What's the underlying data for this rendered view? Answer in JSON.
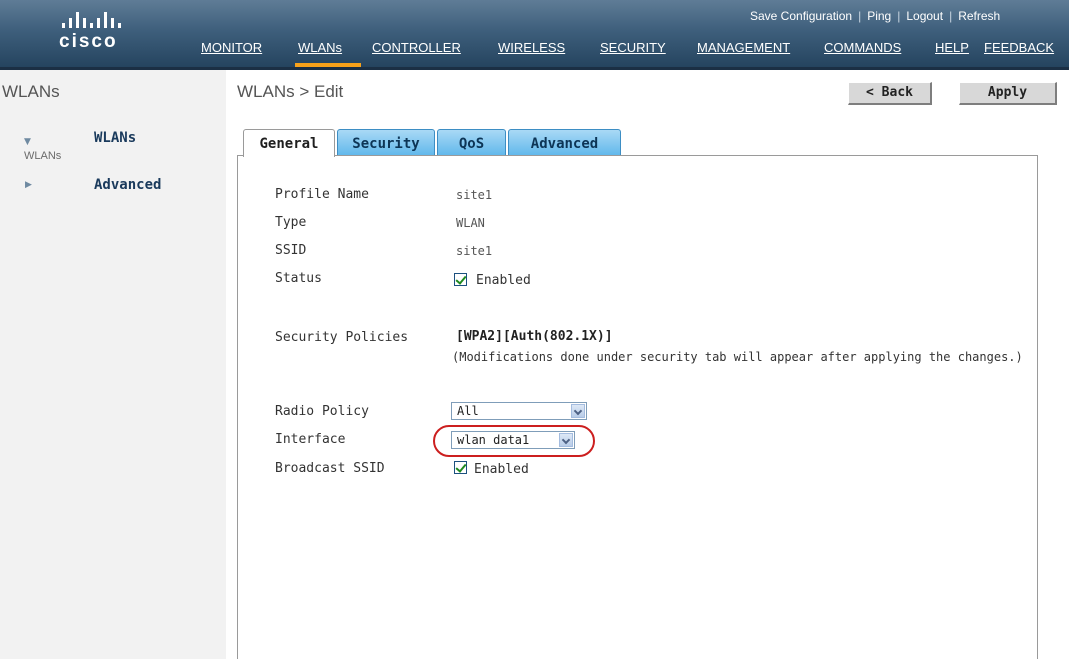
{
  "header": {
    "brand": "cisco",
    "utility": [
      {
        "label": "Save Configuration"
      },
      {
        "label": "Ping"
      },
      {
        "label": "Logout"
      },
      {
        "label": "Refresh"
      }
    ],
    "menu": [
      {
        "label": "MONITOR"
      },
      {
        "label": "WLANs"
      },
      {
        "label": "CONTROLLER"
      },
      {
        "label": "WIRELESS"
      },
      {
        "label": "SECURITY"
      },
      {
        "label": "MANAGEMENT"
      },
      {
        "label": "COMMANDS"
      },
      {
        "label": "HELP"
      },
      {
        "label": "FEEDBACK"
      }
    ],
    "active_menu": "WLANs",
    "accent_color": "#f8a21a"
  },
  "sidebar": {
    "title": "WLANs",
    "items": [
      {
        "label": "WLANs",
        "sub": "WLANs",
        "expanded": true
      },
      {
        "label": "Advanced",
        "expanded": false
      }
    ]
  },
  "main": {
    "breadcrumb": "WLANs > Edit",
    "back_button": "< Back",
    "apply_button": "Apply",
    "tabs": [
      {
        "label": "General",
        "active": true
      },
      {
        "label": "Security",
        "active": false
      },
      {
        "label": "QoS",
        "active": false
      },
      {
        "label": "Advanced",
        "active": false
      }
    ],
    "general": {
      "profile_name": {
        "label": "Profile Name",
        "value": "site1"
      },
      "type": {
        "label": "Type",
        "value": "WLAN"
      },
      "ssid": {
        "label": "SSID",
        "value": "site1"
      },
      "status": {
        "label": "Status",
        "checkbox_label": "Enabled",
        "checked": true
      },
      "security_policies": {
        "label": "Security Policies",
        "value": "[WPA2][Auth(802.1X)]",
        "note": "(Modifications done under security tab will appear after applying the changes.)"
      },
      "radio_policy": {
        "label": "Radio Policy",
        "selected": "All"
      },
      "interface": {
        "label": "Interface",
        "selected": "wlan data1",
        "highlight_color": "#cc1f1f"
      },
      "broadcast_ssid": {
        "label": "Broadcast SSID",
        "checkbox_label": "Enabled",
        "checked": true
      }
    }
  }
}
